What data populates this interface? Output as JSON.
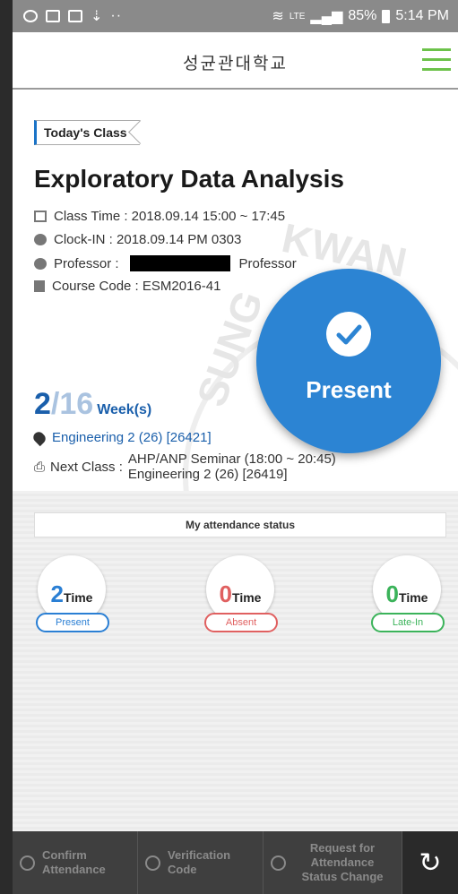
{
  "status_bar": {
    "signal_text": "LTE",
    "battery": "85%",
    "time": "5:14 PM"
  },
  "header": {
    "title": "성균관대학교"
  },
  "class_card": {
    "tag": "Today's Class",
    "course_title": "Exploratory Data Analysis",
    "class_time": "Class Time : 2018.09.14 15:00 ~ 17:45",
    "clock_in": "Clock-IN : 2018.09.14 PM 0303",
    "professor_label": "Professor :",
    "professor_suffix": "Professor",
    "course_code": "Course Code : ESM2016-41",
    "status_label": "Present",
    "week_current": "2",
    "week_total": "/16",
    "week_label": "Week(s)",
    "room": "Engineering 2 (26) [26421]",
    "next_class_label": "Next Class :",
    "next_class_line1": "AHP/ANP Seminar (18:00 ~ 20:45)",
    "next_class_line2": "Engineering 2 (26) [26419]"
  },
  "attendance": {
    "title": "My attendance status",
    "items": [
      {
        "count": "2",
        "unit": "Time",
        "label": "Present",
        "color": "#2a7fd4"
      },
      {
        "count": "0",
        "unit": "Time",
        "label": "Absent",
        "color": "#e06060"
      },
      {
        "count": "0",
        "unit": "Time",
        "label": "Late-In",
        "color": "#3bb35a"
      }
    ]
  },
  "bottom_bar": {
    "confirm": "Confirm Attendance",
    "verification": "Verification Code",
    "request": "Request for Attendance Status Change",
    "refresh_icon": "refresh-icon"
  }
}
